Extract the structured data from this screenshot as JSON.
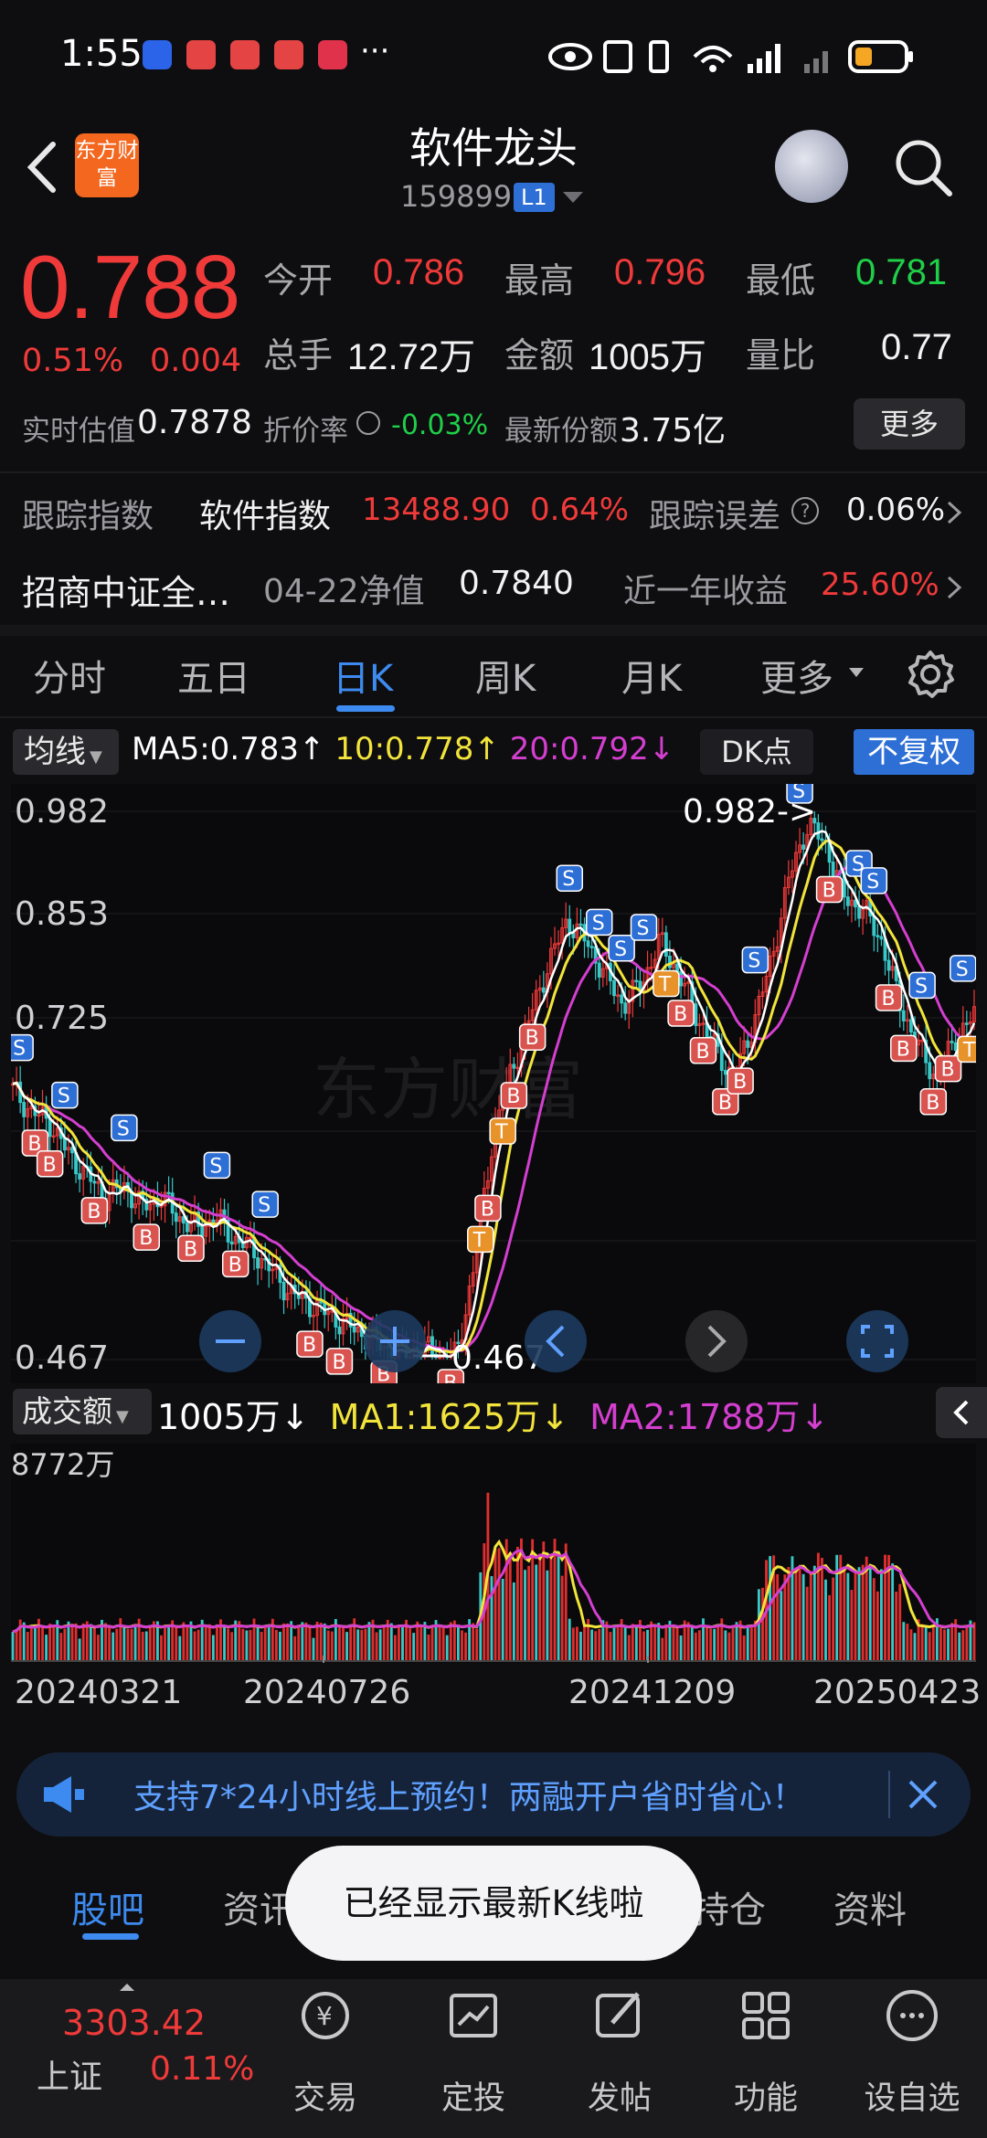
{
  "status_bar": {
    "time": "1:55",
    "more": "···"
  },
  "header": {
    "logo_text": "东方财富",
    "title": "软件龙头",
    "code": "159899",
    "level": "L1"
  },
  "quote": {
    "price": "0.788",
    "pct_change": "0.51%",
    "change": "0.004",
    "open_label": "今开",
    "open": "0.786",
    "high_label": "最高",
    "high": "0.796",
    "low_label": "最低",
    "low": "0.781",
    "volume_label": "总手",
    "volume": "12.72万",
    "amount_label": "金额",
    "amount": "1005万",
    "ratio_label": "量比",
    "ratio": "0.77",
    "iopv_label": "实时估值",
    "iopv": "0.7878",
    "discount_label": "折价率",
    "discount": "-0.03%",
    "shares_label": "最新份额",
    "shares": "3.75亿",
    "more_button": "更多"
  },
  "tracking": {
    "index_label": "跟踪指数",
    "index_name": "软件指数",
    "index_value": "13488.90",
    "index_pct": "0.64%",
    "error_label": "跟踪误差",
    "error_value": "0.06%",
    "fund_name": "招商中证全…",
    "nav_label": "04-22净值",
    "nav_value": "0.7840",
    "yield_label": "近一年收益",
    "yield_value": "25.60%"
  },
  "period_tabs": [
    "分时",
    "五日",
    "日K",
    "周K",
    "月K",
    "更多"
  ],
  "active_period": "日K",
  "ma_bar": {
    "selector": "均线",
    "ma5": "MA5:0.783↑",
    "ma10": "10:0.778↑",
    "ma20": "20:0.792↓",
    "dk_button": "DK点",
    "adjust_button": "不复权"
  },
  "colors": {
    "up": "#f03a3a",
    "down": "#38c8c8",
    "ma5": "#ffffff",
    "ma10": "#f2e43b",
    "ma20": "#d43fd0",
    "accent": "#3d8bf0"
  },
  "chart_data": [
    {
      "type": "candlestick",
      "title": "日K",
      "y_ticks": [
        "0.982",
        "0.853",
        "0.725",
        "0.467"
      ],
      "ylim": [
        0.467,
        0.982
      ],
      "max_annotation": "0.982->",
      "min_annotation": "0.467",
      "x_ticks": [
        "20240321",
        "20240726",
        "20241209",
        "20250423"
      ],
      "close_path_points": [
        0.72,
        0.7,
        0.69,
        0.66,
        0.64,
        0.62,
        0.63,
        0.61,
        0.62,
        0.6,
        0.59,
        0.6,
        0.58,
        0.57,
        0.55,
        0.53,
        0.52,
        0.51,
        0.5,
        0.49,
        0.48,
        0.47,
        0.48,
        0.47,
        0.47,
        0.56,
        0.68,
        0.74,
        0.79,
        0.84,
        0.88,
        0.86,
        0.83,
        0.8,
        0.82,
        0.86,
        0.83,
        0.79,
        0.76,
        0.73,
        0.78,
        0.84,
        0.92,
        0.97,
        0.95,
        0.9,
        0.89,
        0.86,
        0.8,
        0.76,
        0.73,
        0.77,
        0.79
      ]
    },
    {
      "type": "bar",
      "title": "成交额",
      "ymax_label": "8772万",
      "series": [
        {
          "name": "成交额",
          "value": "1005万↓"
        },
        {
          "name": "MA1",
          "value": "1625万↓"
        },
        {
          "name": "MA2",
          "value": "1788万↓"
        }
      ]
    }
  ],
  "volume_bar": {
    "selector": "成交额",
    "current": "1005万↓",
    "ma1": "MA1:1625万↓",
    "ma2": "MA2:1788万↓",
    "max_label": "8772万"
  },
  "dates": [
    "20240321",
    "20240726",
    "20241209",
    "20250423"
  ],
  "banner": {
    "text": "支持7*24小时线上预约！两融开户省时省心！"
  },
  "bottom_tabs": [
    "股吧",
    "资讯",
    "持仓",
    "资料"
  ],
  "toast": "已经显示最新K线啦",
  "navbar": {
    "index_value": "3303.42",
    "index_name": "上证",
    "index_pct": "0.11%",
    "items": [
      "交易",
      "定投",
      "发帖",
      "功能",
      "设自选"
    ]
  }
}
